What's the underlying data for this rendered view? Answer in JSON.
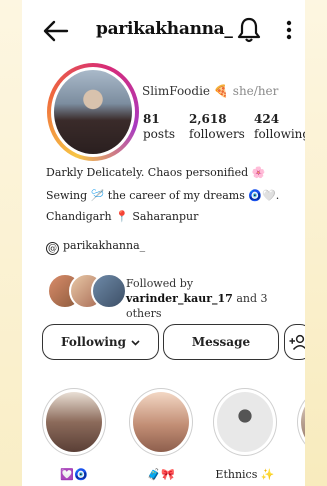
{
  "header": {
    "username": "parikakhanna_"
  },
  "profile": {
    "display_name": "SlimFoodie 🍕",
    "pronouns": "she/her",
    "stats": [
      {
        "value": "81",
        "label": "posts"
      },
      {
        "value": "2,618",
        "label": "followers"
      },
      {
        "value": "424",
        "label": "following"
      }
    ],
    "bio_lines": [
      "Darkly Delicately. Chaos personified 🌸",
      "Sewing 🪡 the career of my dreams 🧿🤍.",
      "Chandigarh 📍 Saharanpur"
    ],
    "threads_handle": "parikakhanna_",
    "followed_by_prefix": "Followed by ",
    "followed_by_user": "varinder_kaur_17",
    "followed_by_suffix": " and 3 others"
  },
  "actions": {
    "following_label": "Following",
    "message_label": "Message"
  },
  "highlights": [
    {
      "label": "💟🧿"
    },
    {
      "label": "🧳🎀"
    },
    {
      "label": "Ethnics ✨"
    },
    {
      "label": ""
    }
  ],
  "icons": {
    "back": "arrow-left-icon",
    "notifications": "bell-icon",
    "more": "more-vertical-icon",
    "threads": "threads-icon",
    "add_user": "add-user-icon",
    "chevron": "chevron-down-icon"
  }
}
